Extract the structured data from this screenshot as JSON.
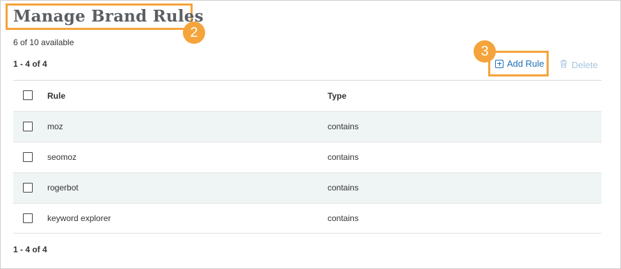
{
  "page": {
    "title": "Manage Brand Rules",
    "availability": "6 of 10 available",
    "pager_top": "1 - 4 of 4",
    "pager_bottom": "1 - 4 of 4"
  },
  "annotations": {
    "title_callout": "2",
    "add_rule_callout": "3",
    "callout_color": "#f5a33b"
  },
  "toolbar": {
    "add_rule_label": "Add Rule",
    "add_rule_icon": "plus-square-icon",
    "delete_label": "Delete",
    "delete_icon": "trash-icon"
  },
  "table": {
    "columns": [
      "Rule",
      "Type"
    ],
    "rows": [
      {
        "rule": "moz",
        "type": "contains"
      },
      {
        "rule": "seomoz",
        "type": "contains"
      },
      {
        "rule": "rogerbot",
        "type": "contains"
      },
      {
        "rule": "keyword explorer",
        "type": "contains"
      }
    ]
  },
  "colors": {
    "link": "#1f6fb2",
    "disabled_link": "#a7c4dd",
    "row_shade": "#eff5f4",
    "title": "#5a5f63"
  }
}
